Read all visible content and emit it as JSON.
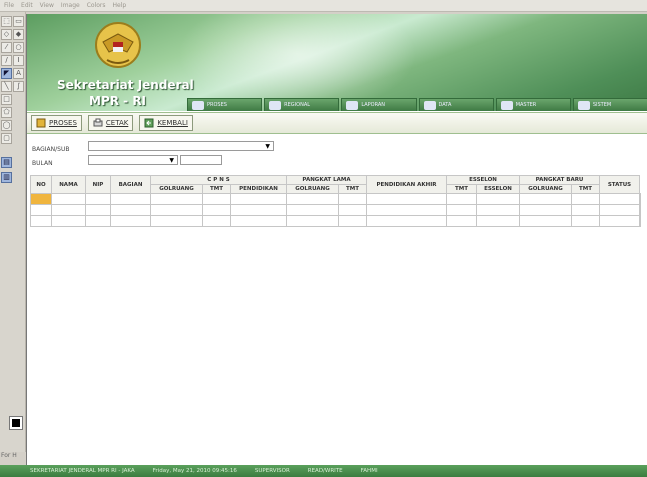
{
  "os_menu": [
    "File",
    "Edit",
    "View",
    "Image",
    "Colors",
    "Help"
  ],
  "brand": {
    "title": "Sekretariat Jenderal",
    "subtitle": "MPR - RI"
  },
  "nav_items": [
    "PROSES",
    "REGIONAL",
    "LAPORAN",
    "DATA",
    "MASTER",
    "SISTEM"
  ],
  "toolbar": {
    "proses_label": "PROSES",
    "cetak_label": "CETAK",
    "kembali_label": "KEMBALI"
  },
  "filters": {
    "bagian_label": "BAGIAN/SUB",
    "bulan_label": "BULAN",
    "bagian_value": "",
    "bulan_value": "",
    "tahun_value": ""
  },
  "table": {
    "header_top": [
      "NO",
      "NAMA",
      "NIP",
      "BAGIAN",
      "C P N S",
      "PANGKAT LAMA",
      "PENDIDIKAN AKHIR",
      "ESSELON",
      "PANGKAT BARU",
      "STATUS"
    ],
    "header_sub": [
      "GOLRUANG",
      "TMT",
      "PENDIDIKAN",
      "GOLRUANG",
      "TMT",
      "TMT",
      "ESSELON",
      "GOLRUANG",
      "TMT"
    ],
    "rows": [
      [
        "",
        "",
        "",
        "",
        "",
        "",
        "",
        "",
        "",
        "",
        "",
        "",
        "",
        "",
        "",
        ""
      ],
      [
        "",
        "",
        "",
        "",
        "",
        "",
        "",
        "",
        "",
        "",
        "",
        "",
        "",
        "",
        "",
        ""
      ],
      [
        "",
        "",
        "",
        "",
        "",
        "",
        "",
        "",
        "",
        "",
        "",
        "",
        "",
        "",
        "",
        ""
      ]
    ]
  },
  "status_bar": [
    "SEKRETARIAT JENDERAL MPR RI - JAKA",
    "Friday, May 21, 2010 09:45:16",
    "SUPERVISOR",
    "READ/WRITE",
    "FAHMI"
  ],
  "colors": {
    "brand_green": "#4f8f58",
    "selection_orange": "#f0b53e"
  }
}
